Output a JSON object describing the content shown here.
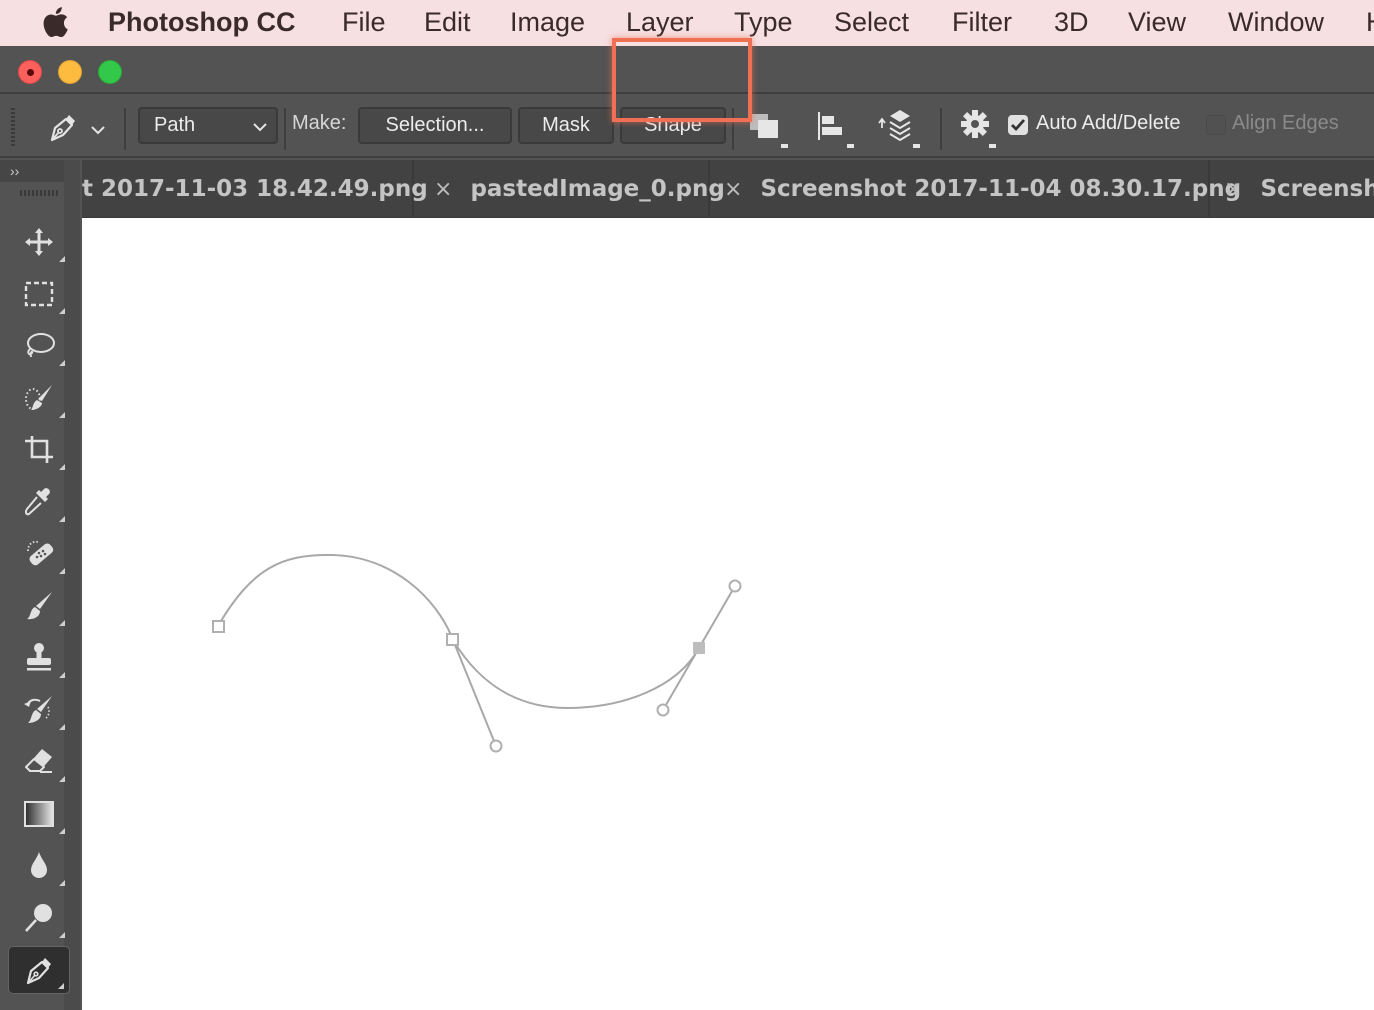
{
  "menubar": {
    "app_name": "Photoshop CC",
    "items": [
      "File",
      "Edit",
      "Image",
      "Layer",
      "Type",
      "Select",
      "Filter",
      "3D",
      "View",
      "Window",
      "H"
    ]
  },
  "options_bar": {
    "tool_icon": "pen-tool-icon",
    "mode_select": {
      "value": "Path"
    },
    "make_label": "Make:",
    "selection_button": "Selection...",
    "mask_button": "Mask",
    "shape_button": "Shape",
    "icons": [
      "path-operations-icon",
      "path-alignment-icon",
      "path-arrangement-icon",
      "gear-icon"
    ],
    "auto_add_delete": {
      "label": "Auto Add/Delete",
      "checked": true
    },
    "align_edges": {
      "label": "Align Edges",
      "checked": false
    }
  },
  "highlight_color": "#f07055",
  "toolbar": {
    "collapse_label": "››",
    "tools": [
      {
        "name": "move-tool",
        "icon": "move-icon"
      },
      {
        "name": "rectangular-marquee-tool",
        "icon": "marquee-icon"
      },
      {
        "name": "lasso-tool",
        "icon": "lasso-icon"
      },
      {
        "name": "quick-selection-tool",
        "icon": "quick-selection-icon"
      },
      {
        "name": "crop-tool",
        "icon": "crop-icon"
      },
      {
        "name": "eyedropper-tool",
        "icon": "eyedropper-icon"
      },
      {
        "name": "healing-brush-tool",
        "icon": "bandage-icon"
      },
      {
        "name": "brush-tool",
        "icon": "brush-icon"
      },
      {
        "name": "clone-stamp-tool",
        "icon": "stamp-icon"
      },
      {
        "name": "history-brush-tool",
        "icon": "history-brush-icon"
      },
      {
        "name": "eraser-tool",
        "icon": "eraser-icon"
      },
      {
        "name": "gradient-tool",
        "icon": "gradient-icon"
      },
      {
        "name": "blur-tool",
        "icon": "drop-icon"
      },
      {
        "name": "dodge-tool",
        "icon": "dodge-icon"
      },
      {
        "name": "pen-tool",
        "icon": "pen-icon",
        "active": true
      }
    ]
  },
  "tabs": [
    {
      "title": "t 2017-11-03 18.42.49.png",
      "close": ""
    },
    {
      "title": "pastedImage_0.png",
      "close": "×"
    },
    {
      "title": "Screenshot 2017-11-04 08.30.17.png",
      "close": "×"
    },
    {
      "title": "Screensho",
      "close": "×"
    }
  ]
}
